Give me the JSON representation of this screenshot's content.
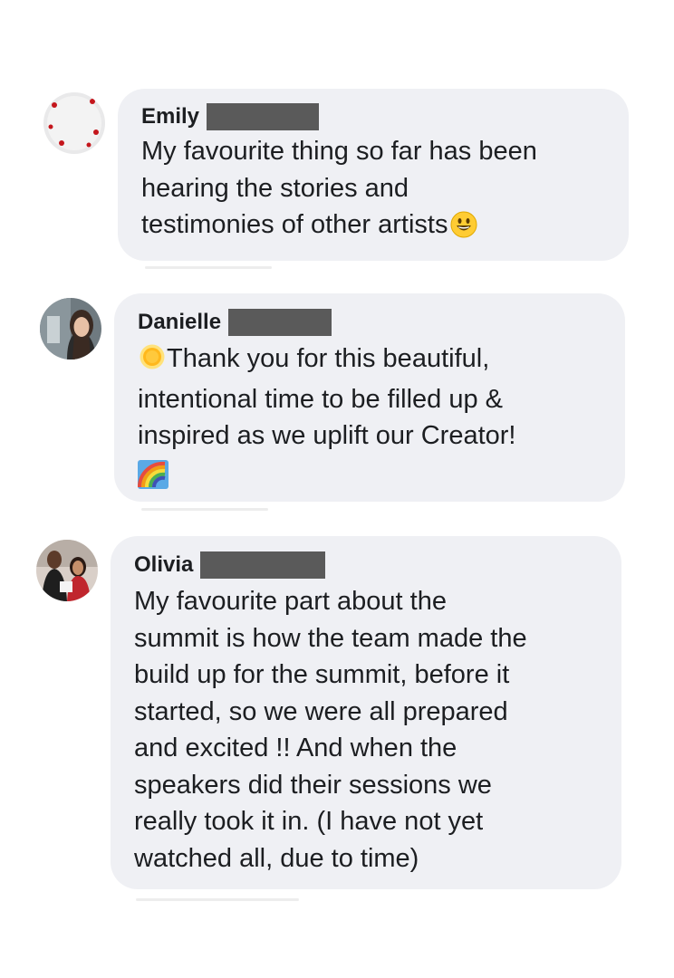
{
  "comments": [
    {
      "author": "Emily",
      "text": "My favourite thing so far has been\nhearing the stories and\ntestimonies of other artists",
      "trailing_emoji": "grinning-face-icon"
    },
    {
      "author": "Danielle",
      "leading_emoji": "sun-icon",
      "text": "Thank you for this beautiful,\nintentional time to be filled up &\ninspired as we uplift our Creator!",
      "trailing_emoji": "rainbow-icon"
    },
    {
      "author": "Olivia",
      "text": "My favourite part about the\nsummit is how the team made the\nbuild up for the summit, before it\nstarted, so we were all prepared\nand excited !! And when the\nspeakers did their sessions we\nreally took it in. (I have not yet\nwatched all, due to time)"
    }
  ],
  "colors": {
    "bubble": "#eff0f4",
    "text": "#1c1e21",
    "redaction": "#5a5a5a"
  }
}
